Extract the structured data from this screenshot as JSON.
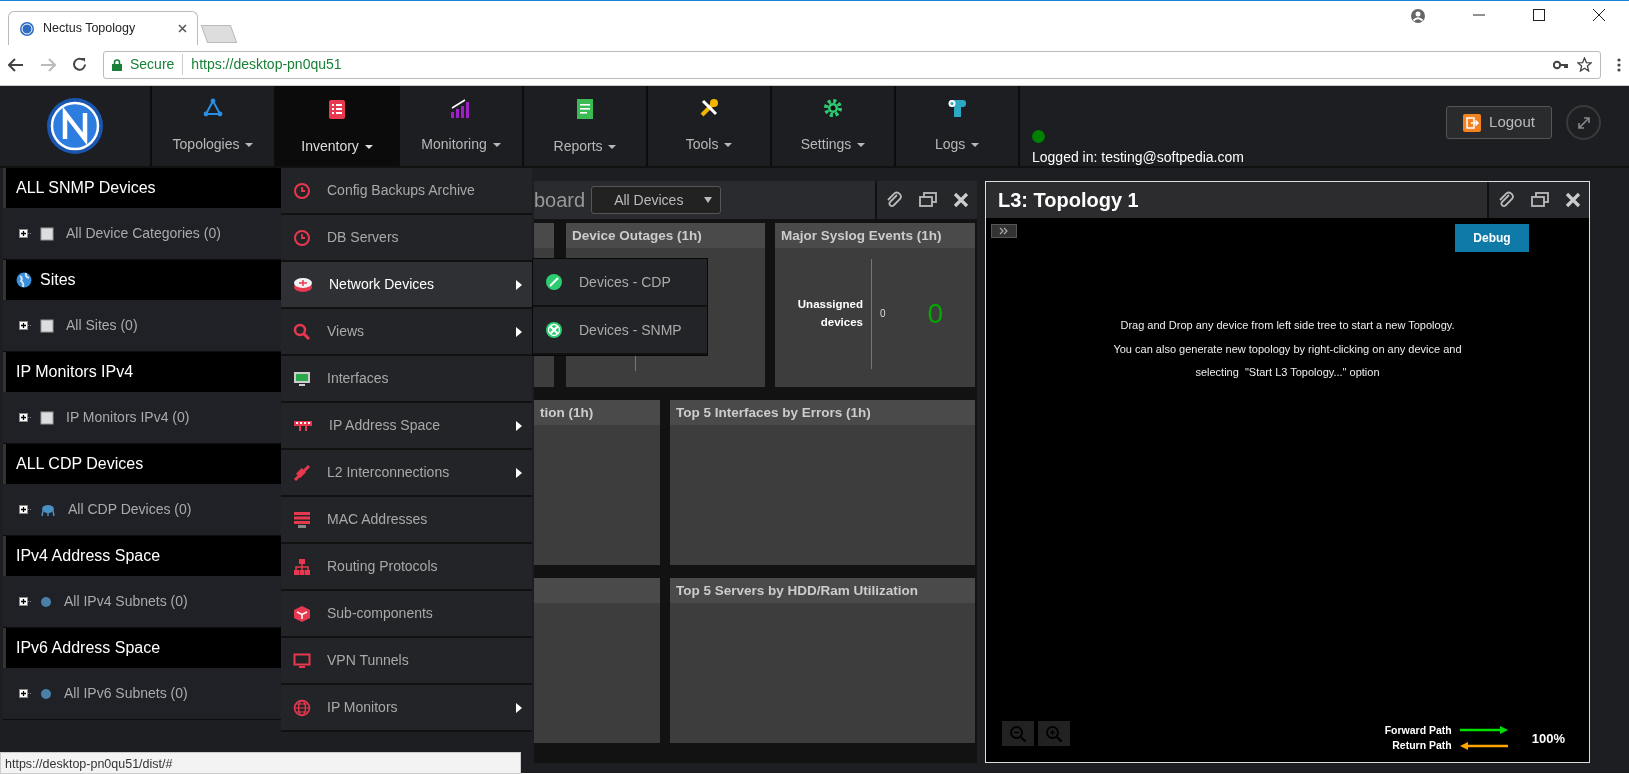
{
  "browser": {
    "tab_title": "Nectus Topology",
    "security": "Secure",
    "url": "https://desktop-pn0qu51",
    "status_url": "https://desktop-pn0qu51/dist/#"
  },
  "nav": [
    {
      "label": "Topologies",
      "selected": false
    },
    {
      "label": "Inventory",
      "selected": true
    },
    {
      "label": "Monitoring",
      "selected": false
    },
    {
      "label": "Reports",
      "selected": false
    },
    {
      "label": "Tools",
      "selected": false
    },
    {
      "label": "Settings",
      "selected": false
    },
    {
      "label": "Logs",
      "selected": false
    }
  ],
  "session": {
    "logged_in": "Logged in: testing@softpedia.com",
    "logout": "Logout"
  },
  "sidebar": [
    {
      "title": "ALL SNMP Devices",
      "item": {
        "label": "All Device Categories (0)",
        "kind": "folder"
      }
    },
    {
      "title": "Sites",
      "item": {
        "label": "All Sites (0)",
        "kind": "folder"
      }
    },
    {
      "title": "IP Monitors IPv4",
      "item": {
        "label": "IP Monitors IPv4 (0)",
        "kind": "folder"
      }
    },
    {
      "title": "ALL CDP Devices",
      "item": {
        "label": "All CDP Devices (0)",
        "kind": "device"
      }
    },
    {
      "title": "IPv4 Address Space",
      "item": {
        "label": "All IPv4 Subnets (0)",
        "kind": "subnet"
      }
    },
    {
      "title": "IPv6 Address Space",
      "item": {
        "label": "All IPv6 Subnets (0)",
        "kind": "subnet"
      }
    }
  ],
  "menu": [
    {
      "label": "Config Backups Archive",
      "submenu": false,
      "selected": false
    },
    {
      "label": "DB Servers",
      "submenu": false,
      "selected": false
    },
    {
      "label": "Network Devices",
      "submenu": true,
      "selected": true
    },
    {
      "label": "Views",
      "submenu": true,
      "selected": false
    },
    {
      "label": "Interfaces",
      "submenu": false,
      "selected": false
    },
    {
      "label": "IP Address Space",
      "submenu": true,
      "selected": false
    },
    {
      "label": "L2 Interconnections",
      "submenu": true,
      "selected": false
    },
    {
      "label": "MAC Addresses",
      "submenu": false,
      "selected": false
    },
    {
      "label": "Routing Protocols",
      "submenu": false,
      "selected": false
    },
    {
      "label": "Sub-components",
      "submenu": false,
      "selected": false
    },
    {
      "label": "VPN Tunnels",
      "submenu": false,
      "selected": false
    },
    {
      "label": "IP Monitors",
      "submenu": true,
      "selected": false
    }
  ],
  "submenu": [
    {
      "label": "Devices - CDP"
    },
    {
      "label": "Devices - SNMP"
    }
  ],
  "dashboard": {
    "title": "board",
    "filter": "All Devices",
    "rows": [
      [
        {},
        {
          "title": "Device Outages (1h)",
          "kind": "split"
        },
        {
          "title": "Major Syslog Events (1h)",
          "kind": "syslog",
          "label": "Unassigned devices",
          "count": "0",
          "total": "0"
        }
      ],
      [
        {
          "title": "tion (1h)"
        },
        {
          "title": "Top 5 Interfaces by Errors (1h)"
        }
      ],
      [
        {},
        {
          "title": "Top 5 Servers by HDD/Ram Utilization"
        }
      ]
    ]
  },
  "topology": {
    "title": "L3: Topology 1",
    "debug": "Debug",
    "hint": [
      "Drag and Drop any device from left side tree to start a new Topology.",
      "You can also generate new topology by right-clicking on any device and",
      "selecting  \"Start L3 Topology...\" option"
    ],
    "legend": [
      {
        "label": "Forward Path",
        "kind": "forward",
        "color": "#00e000"
      },
      {
        "label": "Return Path",
        "kind": "return",
        "color": "#ffa500"
      }
    ],
    "zoom": "100%"
  }
}
